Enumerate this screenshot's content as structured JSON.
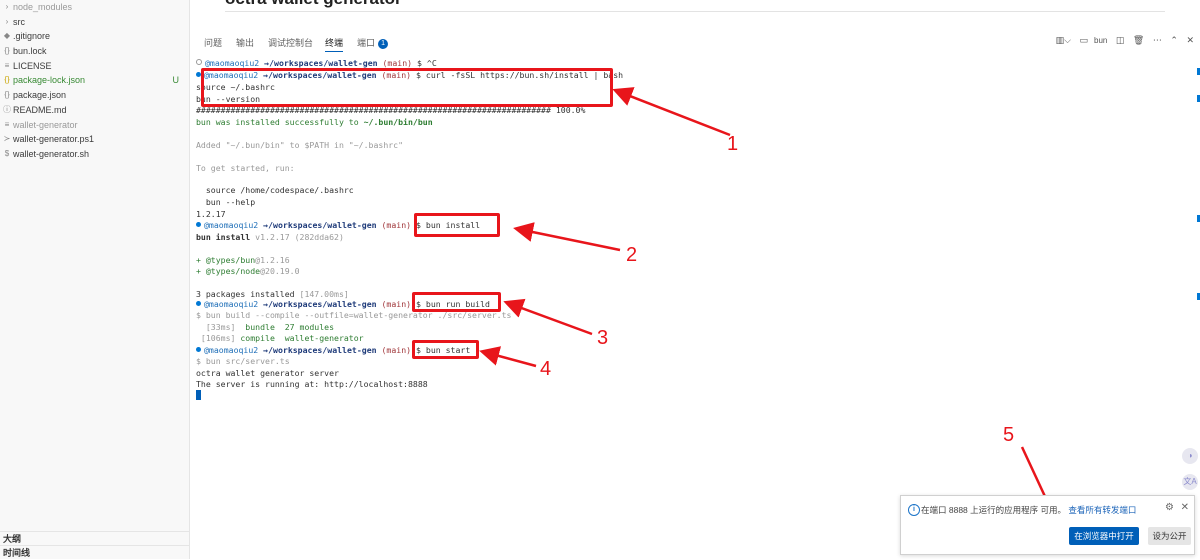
{
  "explorer": {
    "items": [
      {
        "icon": "chevron-right",
        "name": "node_modules",
        "dim": true
      },
      {
        "icon": "chevron-right",
        "name": "src"
      },
      {
        "icon": "gear-diamond",
        "name": ".gitignore"
      },
      {
        "icon": "{}",
        "name": "bun.lock"
      },
      {
        "icon": "license",
        "name": "LICENSE"
      },
      {
        "icon": "{}",
        "name": "package-lock.json",
        "status": "U",
        "modified": true
      },
      {
        "icon": "{}",
        "name": "package.json"
      },
      {
        "icon": "info",
        "name": "README.md"
      },
      {
        "icon": "lines",
        "name": "wallet-generator",
        "dim": true
      },
      {
        "icon": "powershell",
        "name": "wallet-generator.ps1"
      },
      {
        "icon": "$",
        "name": "wallet-generator.sh"
      }
    ],
    "outline_label": "大纲",
    "timeline_label": "时间线"
  },
  "editor": {
    "heading": "octra wallet generator"
  },
  "panel": {
    "tabs": [
      "问题",
      "输出",
      "调试控制台",
      "终端",
      "端口"
    ],
    "active_tab": "终端",
    "ports_count": "1",
    "terminal_label": "bun"
  },
  "terminal": {
    "user": "@maomaoqiu2",
    "arrow": "→",
    "path": "/workspaces/wallet-gen",
    "branch": "(main)",
    "prompt_sym": "$",
    "lines": {
      "l1_cmd": "^C",
      "l2_cmd": "curl -fsSL https://bun.sh/install | bash",
      "l3": "source ~/.bashrc",
      "l4": "bun --version",
      "l5": "######################################################################## 100.0%",
      "l6a": "bun was installed successfully to ",
      "l6b": "~/.bun/bin/bun",
      "l7": "Added \"~/.bun/bin\" to $PATH in \"~/.bashrc\"",
      "l8": "To get started, run:",
      "l9": "  source /home/codespace/.bashrc",
      "l10": "  bun --help",
      "l11": "1.2.17",
      "l12_cmd": "bun install",
      "l13a": "bun install ",
      "l13b": "v1.2.17 (282dda62)",
      "l14a": "+ @types/bun",
      "l14b": "@1.2.16",
      "l15a": "+ @types/node",
      "l15b": "@20.19.0",
      "l16a": "3 packages installed ",
      "l16b": "[147.00ms]",
      "l17_cmd": "bun run build",
      "l18": "$ bun build --compile --outfile=wallet-generator ./src/server.ts",
      "l19a": "  [33ms]",
      "l19b": "  bundle  27 modules",
      "l20a": " [106ms]",
      "l20b": " compile  wallet-generator",
      "l21_cmd": "bun start",
      "l22": "$ bun src/server.ts",
      "l23": "octra wallet generator server",
      "l24": "The server is running at: http://localhost:8888"
    }
  },
  "annotations": [
    "1",
    "2",
    "3",
    "4",
    "5"
  ],
  "notification": {
    "message": "在端口 8888 上运行的应用程序 可用。",
    "link": "查看所有转发端口",
    "open_button": "在浏览器中打开",
    "public_button": "设为公开"
  },
  "colors": {
    "accent": "#005fb8",
    "annotation_red": "#e8151b",
    "git_untracked": "#388a34"
  }
}
